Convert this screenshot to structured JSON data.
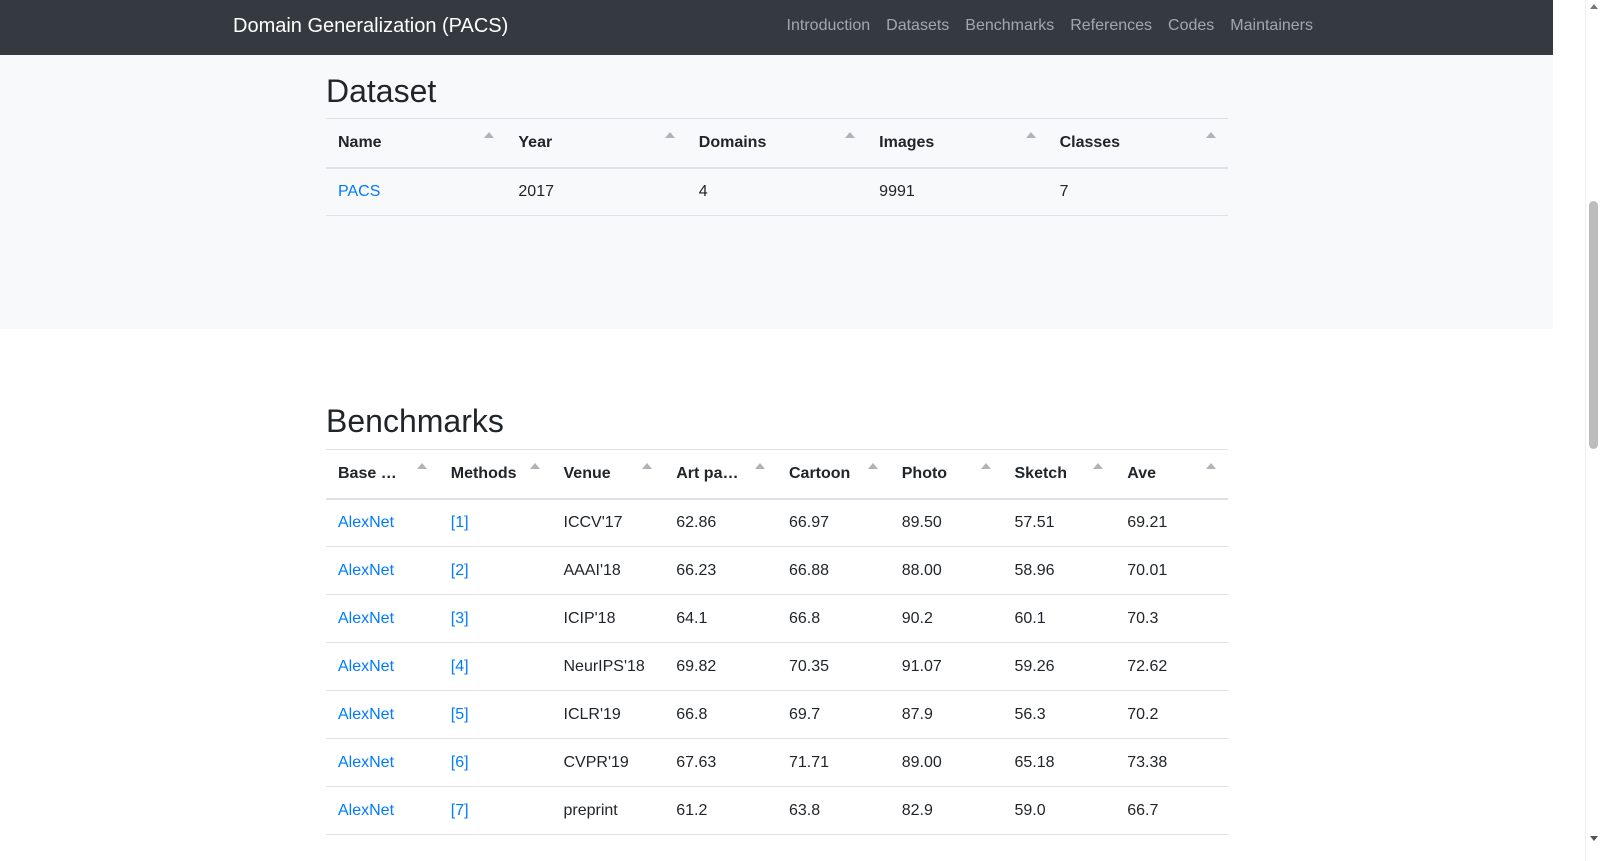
{
  "navbar": {
    "brand": "Domain Generalization (PACS)",
    "links": [
      "Introduction",
      "Datasets",
      "Benchmarks",
      "References",
      "Codes",
      "Maintainers"
    ]
  },
  "dataset": {
    "title": "Dataset",
    "headers": [
      "Name",
      "Year",
      "Domains",
      "Images",
      "Classes"
    ],
    "rows": [
      [
        "PACS",
        "2017",
        "4",
        "9991",
        "7"
      ]
    ]
  },
  "benchmarks": {
    "title": "Benchmarks",
    "headers": [
      "Base …",
      "Methods",
      "Venue",
      "Art pa…",
      "Cartoon",
      "Photo",
      "Sketch",
      "Ave"
    ],
    "rows": [
      [
        "AlexNet",
        "[1]",
        "ICCV'17",
        "62.86",
        "66.97",
        "89.50",
        "57.51",
        "69.21"
      ],
      [
        "AlexNet",
        "[2]",
        "AAAI'18",
        "66.23",
        "66.88",
        "88.00",
        "58.96",
        "70.01"
      ],
      [
        "AlexNet",
        "[3]",
        "ICIP'18",
        "64.1",
        "66.8",
        "90.2",
        "60.1",
        "70.3"
      ],
      [
        "AlexNet",
        "[4]",
        "NeurIPS'18",
        "69.82",
        "70.35",
        "91.07",
        "59.26",
        "72.62"
      ],
      [
        "AlexNet",
        "[5]",
        "ICLR'19",
        "66.8",
        "69.7",
        "87.9",
        "56.3",
        "70.2"
      ],
      [
        "AlexNet",
        "[6]",
        "CVPR'19",
        "67.63",
        "71.71",
        "89.00",
        "65.18",
        "73.38"
      ],
      [
        "AlexNet",
        "[7]",
        "preprint",
        "61.2",
        "63.8",
        "82.9",
        "59.0",
        "66.7"
      ]
    ]
  },
  "colors": {
    "navbar_bg": "#343a40",
    "link": "#007bff",
    "section_bg": "#f8f9fa"
  }
}
